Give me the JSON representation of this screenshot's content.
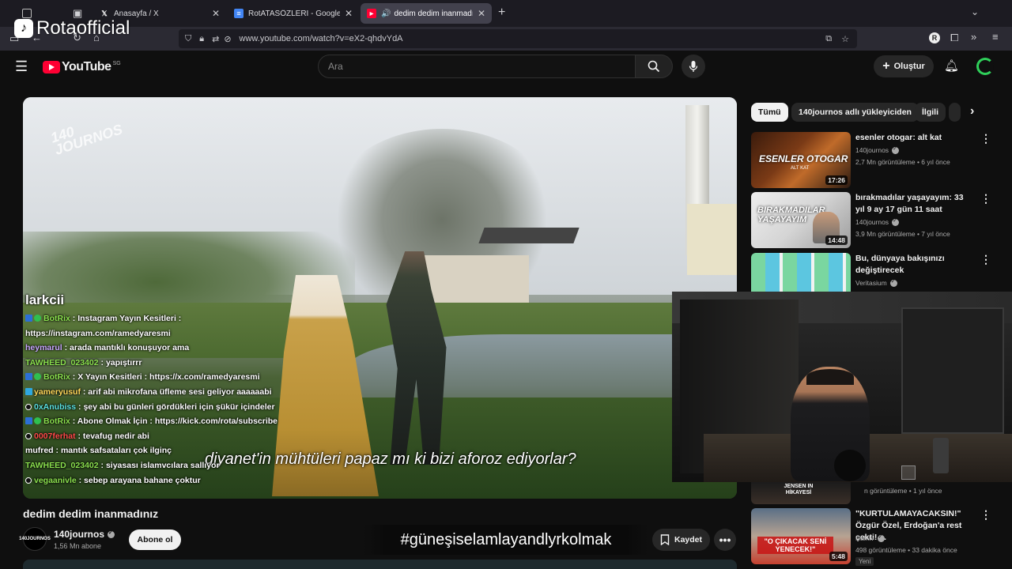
{
  "browser": {
    "tabs": [
      {
        "title": "",
        "type": "system"
      },
      {
        "title": "Anasayfa / X",
        "active": false
      },
      {
        "title": "RotATASÖZLERİ - Google Dokü...",
        "active": false
      },
      {
        "title": "dedim dedim inanmadınız -",
        "active": true
      }
    ],
    "url": "www.youtube.com/watch?v=eX2-qhdvYdA",
    "new_tab": "+",
    "profile_letter": "R"
  },
  "watermark": {
    "logo": "♪",
    "name": "Rotaofficial"
  },
  "youtube": {
    "logo_text": "YouTube",
    "country": "SG",
    "search_placeholder": "Ara",
    "create_label": "Oluştur"
  },
  "video": {
    "brand_mark_line1": "140",
    "brand_mark_line2": "JOURNOS",
    "subtitle": "diyanet'in mühtüleri papaz mı ki bizi aforoz ediyorlar?",
    "chat_handle": "larkcii",
    "chat": [
      {
        "user": "BotRix",
        "msg": "Instagram Yayın Kesitleri :",
        "badges": "bot",
        "color": "#8be04e"
      },
      {
        "user": "",
        "msg": "https://instagram.com/ramedyaresmi",
        "badges": "none",
        "color": "#ffffff"
      },
      {
        "user": "heymarul",
        "msg": "arada mantıklı konuşuyor ama",
        "badges": "none",
        "color": "#c9a7ff"
      },
      {
        "user": "TAWHEED_023402",
        "msg": "yapıştırrr",
        "badges": "none",
        "color": "#8be04e"
      },
      {
        "user": "BotRix",
        "msg": "X Yayın Kesitleri : https://x.com/ramedyaresmi",
        "badges": "bot",
        "color": "#8be04e"
      },
      {
        "user": "yameryusuf",
        "msg": "arif abi mikrofana üfleme sesi geliyor aaaaaabi",
        "badges": "gem",
        "color": "#ffd75a"
      },
      {
        "user": "0xAnubiss",
        "msg": "şey abi bu günleri gördükleri için şükür içindeler",
        "badges": "dot",
        "color": "#5ae0e0"
      },
      {
        "user": "BotRix",
        "msg": "Abone Olmak İçin : https://kick.com/rota/subscribe",
        "badges": "bot",
        "color": "#8be04e"
      },
      {
        "user": "0007ferhat",
        "msg": "tevafug nedir abi",
        "badges": "dot",
        "color": "#ff4a4a"
      },
      {
        "user": "mufred",
        "msg": "mantık safsataları çok ilginç",
        "badges": "none",
        "color": "#ffffff"
      },
      {
        "user": "TAWHEED_023402",
        "msg": "siyasası islamvcılara sallıyor",
        "badges": "none",
        "color": "#8be04e"
      },
      {
        "user": "vegaanivle",
        "msg": "sebep arayana bahane çoktur",
        "badges": "dot",
        "color": "#8be04e"
      }
    ]
  },
  "below": {
    "title": "dedim dedim inanmadınız",
    "channel_name": "140journos",
    "channel_avatar_text": "140JOURNOS",
    "subscribers": "1,56 Mn abone",
    "subscribe_label": "Abone ol",
    "hashtag": "#güneşiselamlayandlyrkolmak",
    "save_label": "Kaydet",
    "more": "•••"
  },
  "sidebar": {
    "chips": [
      "Tümü",
      "140journos adlı yükleyiciden",
      "İlgili"
    ],
    "recs": [
      {
        "title": "esenler otogar: alt kat",
        "channel": "140journos",
        "meta": "2,7 Mn görüntüleme • 6 yıl önce",
        "duration": "17:26",
        "thumb_text": "ESENLER OTOGAR",
        "thumb_sub": "ALT KAT"
      },
      {
        "title": "bırakmadılar yaşayayım: 33 yıl 9 ay 17 gün 11 saat",
        "channel": "140journos",
        "meta": "3,9 Mn görüntüleme • 7 yıl önce",
        "duration": "14:48",
        "thumb_text": "BIRAKMADILAR YAŞAYAYIM"
      },
      {
        "title": "Bu, dünyaya bakışınızı değiştirecek",
        "channel": "Veritasium",
        "meta": "",
        "duration": ""
      },
      {
        "title": "",
        "channel": "",
        "meta": "n görüntüleme • 1 yıl önce",
        "duration": "",
        "thumb_text": "JENSEN IN HİKAYESİ"
      },
      {
        "title": "\"KURTULAMAYACAKSIN!\" Özgür Özel, Erdoğan'a rest çekti! ...",
        "channel": "Halktv",
        "meta": "498 görüntüleme • 33 dakika önce",
        "duration": "5:48",
        "badge": "Yeni",
        "thumb_text": "\"O ÇIKACAK SENİ YENECEK!\""
      }
    ]
  },
  "colors": {
    "yt_red": "#ff0033",
    "bg": "#0f0f0f"
  }
}
